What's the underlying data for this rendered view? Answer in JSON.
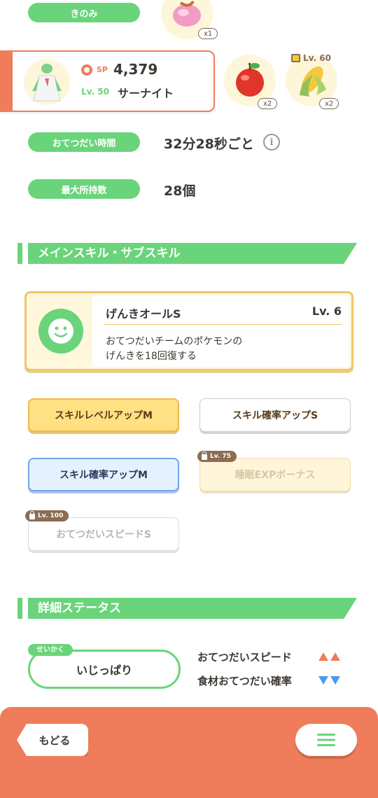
{
  "top": {
    "ingredient_label": "きのみ",
    "berry_qty": "x1"
  },
  "pokemon_card": {
    "sp_label": "SP",
    "sp_value": "4,379",
    "level": "Lv. 50",
    "name": "サーナイト"
  },
  "ingredients": [
    {
      "icon": "apple-icon",
      "qty": "x2"
    },
    {
      "icon": "corn-icon",
      "qty": "x2",
      "lock_level": "Lv. 60"
    }
  ],
  "help_time": {
    "label": "おてつだい時間",
    "value": "32分28秒ごと"
  },
  "max_carry": {
    "label": "最大所持数",
    "value": "28個"
  },
  "skills_section": {
    "title": "メインスキル・サブスキル",
    "main_skill": {
      "name": "げんきオールS",
      "level": "Lv. 6",
      "desc_line1": "おてつだいチームのポケモンの",
      "desc_line2": "げんきを18回復する"
    },
    "sub_skills": [
      {
        "label": "スキルレベルアップM",
        "style": "gold"
      },
      {
        "label": "スキル確率アップS",
        "style": "white"
      },
      {
        "label": "スキル確率アップM",
        "style": "blue"
      },
      {
        "label": "睡眠EXPボーナス",
        "style": "locked-gold",
        "lock_level": "Lv. 75"
      },
      {
        "label": "おてつだいスピードS",
        "style": "locked-white",
        "lock_level": "Lv. 100"
      }
    ]
  },
  "details_section": {
    "title": "詳細ステータス",
    "nature_label": "せいかく",
    "nature_value": "いじっぱり",
    "stat_up": "おてつだいスピード",
    "stat_down": "食材おてつだい確率",
    "colors": {
      "up": "#ef7c5a",
      "down": "#4a9af0"
    }
  },
  "footer": {
    "back_label": "もどる",
    "menu_icon": "hamburger-menu-icon"
  }
}
